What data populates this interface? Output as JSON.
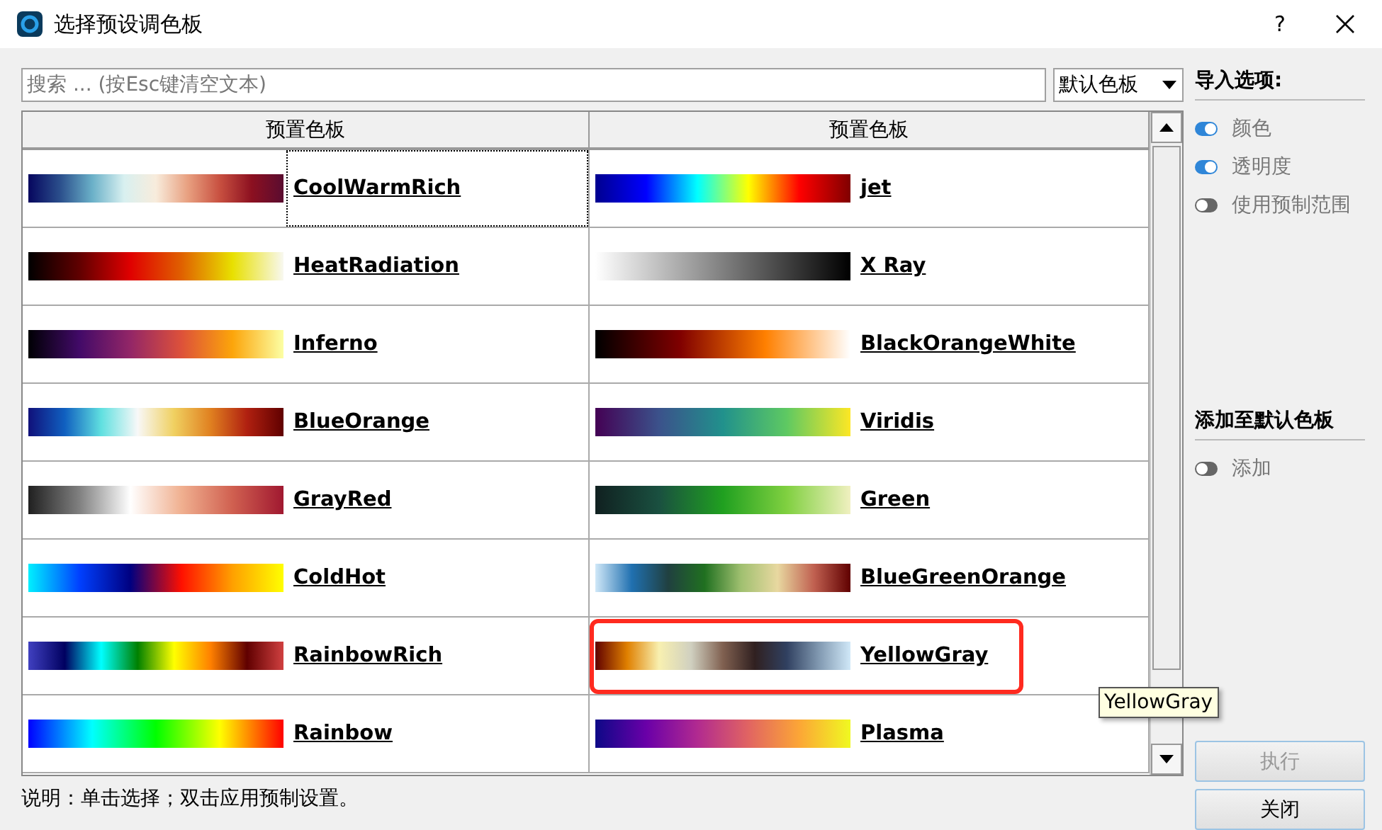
{
  "window": {
    "title": "选择预设调色板",
    "help": "?"
  },
  "search": {
    "placeholder": "搜索 ... (按Esc键清空文本)"
  },
  "preset_select": {
    "value": "默认色板"
  },
  "table": {
    "columns": [
      "预置色板",
      "预置色板"
    ],
    "rows": [
      {
        "cells": [
          {
            "name": "CoolWarmRich",
            "focused": true,
            "highlighted": false
          },
          {
            "name": "jet",
            "focused": false,
            "highlighted": false
          }
        ]
      },
      {
        "cells": [
          {
            "name": "HeatRadiation",
            "focused": false,
            "highlighted": false
          },
          {
            "name": "X Ray",
            "focused": false,
            "highlighted": false
          }
        ]
      },
      {
        "cells": [
          {
            "name": "Inferno",
            "focused": false,
            "highlighted": false
          },
          {
            "name": "BlackOrangeWhite",
            "focused": false,
            "highlighted": false
          }
        ]
      },
      {
        "cells": [
          {
            "name": "BlueOrange",
            "focused": false,
            "highlighted": false
          },
          {
            "name": "Viridis",
            "focused": false,
            "highlighted": false
          }
        ]
      },
      {
        "cells": [
          {
            "name": "GrayRed",
            "focused": false,
            "highlighted": false
          },
          {
            "name": "Green",
            "focused": false,
            "highlighted": false
          }
        ]
      },
      {
        "cells": [
          {
            "name": "ColdHot",
            "focused": false,
            "highlighted": false
          },
          {
            "name": "BlueGreenOrange",
            "focused": false,
            "highlighted": false
          }
        ]
      },
      {
        "cells": [
          {
            "name": "RainbowRich",
            "focused": false,
            "highlighted": false
          },
          {
            "name": "YellowGray",
            "focused": false,
            "highlighted": true
          }
        ]
      },
      {
        "cells": [
          {
            "name": "Rainbow",
            "focused": false,
            "highlighted": false
          },
          {
            "name": "Plasma",
            "focused": false,
            "highlighted": false
          }
        ]
      }
    ]
  },
  "tooltip": "YellowGray",
  "import_options": {
    "title": "导入选项:",
    "options": [
      {
        "label": "颜色",
        "on": true
      },
      {
        "label": "透明度",
        "on": true
      },
      {
        "label": "使用预制范围",
        "on": false
      }
    ]
  },
  "add_default": {
    "title": "添加至默认色板",
    "options": [
      {
        "label": "添加",
        "on": false
      }
    ]
  },
  "buttons": [
    {
      "label": "执行",
      "disabled": true
    },
    {
      "label": "关闭",
      "disabled": false
    }
  ],
  "hint": "说明：单击选择；双击应用预制设置。"
}
